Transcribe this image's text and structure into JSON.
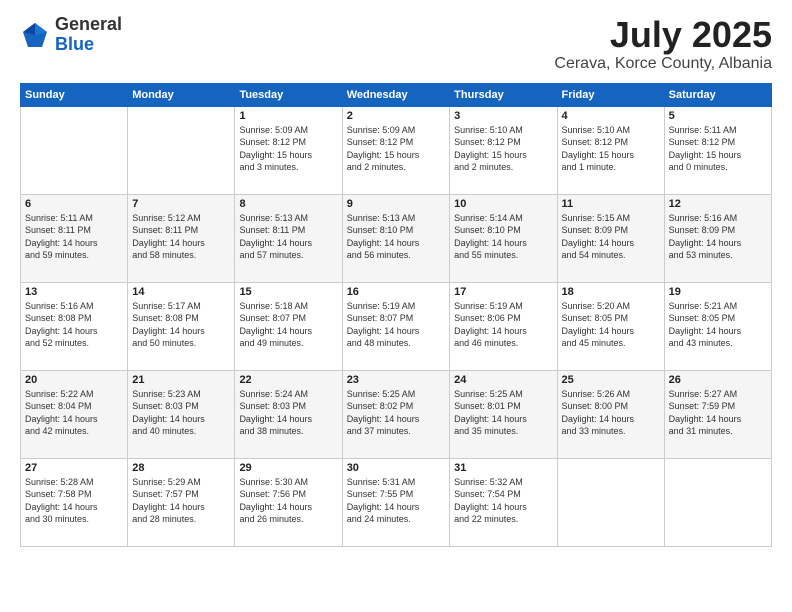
{
  "logo": {
    "general": "General",
    "blue": "Blue"
  },
  "title": {
    "month": "July 2025",
    "location": "Cerava, Korce County, Albania"
  },
  "header_days": [
    "Sunday",
    "Monday",
    "Tuesday",
    "Wednesday",
    "Thursday",
    "Friday",
    "Saturday"
  ],
  "weeks": [
    [
      {
        "day": "",
        "info": ""
      },
      {
        "day": "",
        "info": ""
      },
      {
        "day": "1",
        "info": "Sunrise: 5:09 AM\nSunset: 8:12 PM\nDaylight: 15 hours\nand 3 minutes."
      },
      {
        "day": "2",
        "info": "Sunrise: 5:09 AM\nSunset: 8:12 PM\nDaylight: 15 hours\nand 2 minutes."
      },
      {
        "day": "3",
        "info": "Sunrise: 5:10 AM\nSunset: 8:12 PM\nDaylight: 15 hours\nand 2 minutes."
      },
      {
        "day": "4",
        "info": "Sunrise: 5:10 AM\nSunset: 8:12 PM\nDaylight: 15 hours\nand 1 minute."
      },
      {
        "day": "5",
        "info": "Sunrise: 5:11 AM\nSunset: 8:12 PM\nDaylight: 15 hours\nand 0 minutes."
      }
    ],
    [
      {
        "day": "6",
        "info": "Sunrise: 5:11 AM\nSunset: 8:11 PM\nDaylight: 14 hours\nand 59 minutes."
      },
      {
        "day": "7",
        "info": "Sunrise: 5:12 AM\nSunset: 8:11 PM\nDaylight: 14 hours\nand 58 minutes."
      },
      {
        "day": "8",
        "info": "Sunrise: 5:13 AM\nSunset: 8:11 PM\nDaylight: 14 hours\nand 57 minutes."
      },
      {
        "day": "9",
        "info": "Sunrise: 5:13 AM\nSunset: 8:10 PM\nDaylight: 14 hours\nand 56 minutes."
      },
      {
        "day": "10",
        "info": "Sunrise: 5:14 AM\nSunset: 8:10 PM\nDaylight: 14 hours\nand 55 minutes."
      },
      {
        "day": "11",
        "info": "Sunrise: 5:15 AM\nSunset: 8:09 PM\nDaylight: 14 hours\nand 54 minutes."
      },
      {
        "day": "12",
        "info": "Sunrise: 5:16 AM\nSunset: 8:09 PM\nDaylight: 14 hours\nand 53 minutes."
      }
    ],
    [
      {
        "day": "13",
        "info": "Sunrise: 5:16 AM\nSunset: 8:08 PM\nDaylight: 14 hours\nand 52 minutes."
      },
      {
        "day": "14",
        "info": "Sunrise: 5:17 AM\nSunset: 8:08 PM\nDaylight: 14 hours\nand 50 minutes."
      },
      {
        "day": "15",
        "info": "Sunrise: 5:18 AM\nSunset: 8:07 PM\nDaylight: 14 hours\nand 49 minutes."
      },
      {
        "day": "16",
        "info": "Sunrise: 5:19 AM\nSunset: 8:07 PM\nDaylight: 14 hours\nand 48 minutes."
      },
      {
        "day": "17",
        "info": "Sunrise: 5:19 AM\nSunset: 8:06 PM\nDaylight: 14 hours\nand 46 minutes."
      },
      {
        "day": "18",
        "info": "Sunrise: 5:20 AM\nSunset: 8:05 PM\nDaylight: 14 hours\nand 45 minutes."
      },
      {
        "day": "19",
        "info": "Sunrise: 5:21 AM\nSunset: 8:05 PM\nDaylight: 14 hours\nand 43 minutes."
      }
    ],
    [
      {
        "day": "20",
        "info": "Sunrise: 5:22 AM\nSunset: 8:04 PM\nDaylight: 14 hours\nand 42 minutes."
      },
      {
        "day": "21",
        "info": "Sunrise: 5:23 AM\nSunset: 8:03 PM\nDaylight: 14 hours\nand 40 minutes."
      },
      {
        "day": "22",
        "info": "Sunrise: 5:24 AM\nSunset: 8:03 PM\nDaylight: 14 hours\nand 38 minutes."
      },
      {
        "day": "23",
        "info": "Sunrise: 5:25 AM\nSunset: 8:02 PM\nDaylight: 14 hours\nand 37 minutes."
      },
      {
        "day": "24",
        "info": "Sunrise: 5:25 AM\nSunset: 8:01 PM\nDaylight: 14 hours\nand 35 minutes."
      },
      {
        "day": "25",
        "info": "Sunrise: 5:26 AM\nSunset: 8:00 PM\nDaylight: 14 hours\nand 33 minutes."
      },
      {
        "day": "26",
        "info": "Sunrise: 5:27 AM\nSunset: 7:59 PM\nDaylight: 14 hours\nand 31 minutes."
      }
    ],
    [
      {
        "day": "27",
        "info": "Sunrise: 5:28 AM\nSunset: 7:58 PM\nDaylight: 14 hours\nand 30 minutes."
      },
      {
        "day": "28",
        "info": "Sunrise: 5:29 AM\nSunset: 7:57 PM\nDaylight: 14 hours\nand 28 minutes."
      },
      {
        "day": "29",
        "info": "Sunrise: 5:30 AM\nSunset: 7:56 PM\nDaylight: 14 hours\nand 26 minutes."
      },
      {
        "day": "30",
        "info": "Sunrise: 5:31 AM\nSunset: 7:55 PM\nDaylight: 14 hours\nand 24 minutes."
      },
      {
        "day": "31",
        "info": "Sunrise: 5:32 AM\nSunset: 7:54 PM\nDaylight: 14 hours\nand 22 minutes."
      },
      {
        "day": "",
        "info": ""
      },
      {
        "day": "",
        "info": ""
      }
    ]
  ]
}
